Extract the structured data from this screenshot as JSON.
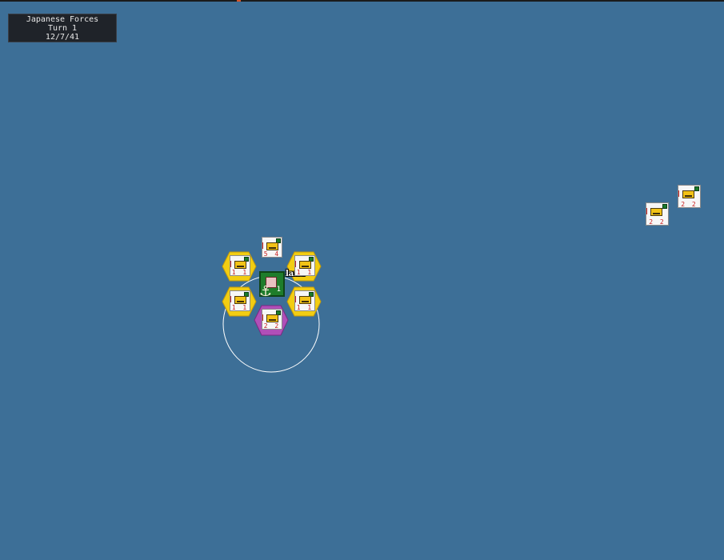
{
  "info_panel": {
    "side": "Japanese Forces",
    "turn": "Turn 1",
    "date": "12/7/41"
  },
  "map": {
    "sea_color": "#3d6f97",
    "island_label": "land",
    "base_number": "1",
    "colors": {
      "allied_hex": "#f2cd12",
      "selected_hex": "#b04fb8",
      "base_green": "#1e7d2b",
      "range_circle": "#ffffff"
    }
  },
  "units": [
    {
      "id": "unit-north",
      "vals": "5 4",
      "group": "island"
    },
    {
      "id": "unit-nw",
      "vals": "1 1",
      "group": "island"
    },
    {
      "id": "unit-ne",
      "vals": "1 1",
      "group": "island"
    },
    {
      "id": "unit-sw",
      "vals": "1 1",
      "group": "island"
    },
    {
      "id": "unit-se",
      "vals": "1 1",
      "group": "island"
    },
    {
      "id": "unit-south-selected",
      "vals": "2 2",
      "group": "island"
    },
    {
      "id": "unit-east-a",
      "vals": "2 2",
      "group": "east"
    },
    {
      "id": "unit-east-b",
      "vals": "2 2",
      "group": "east"
    }
  ]
}
